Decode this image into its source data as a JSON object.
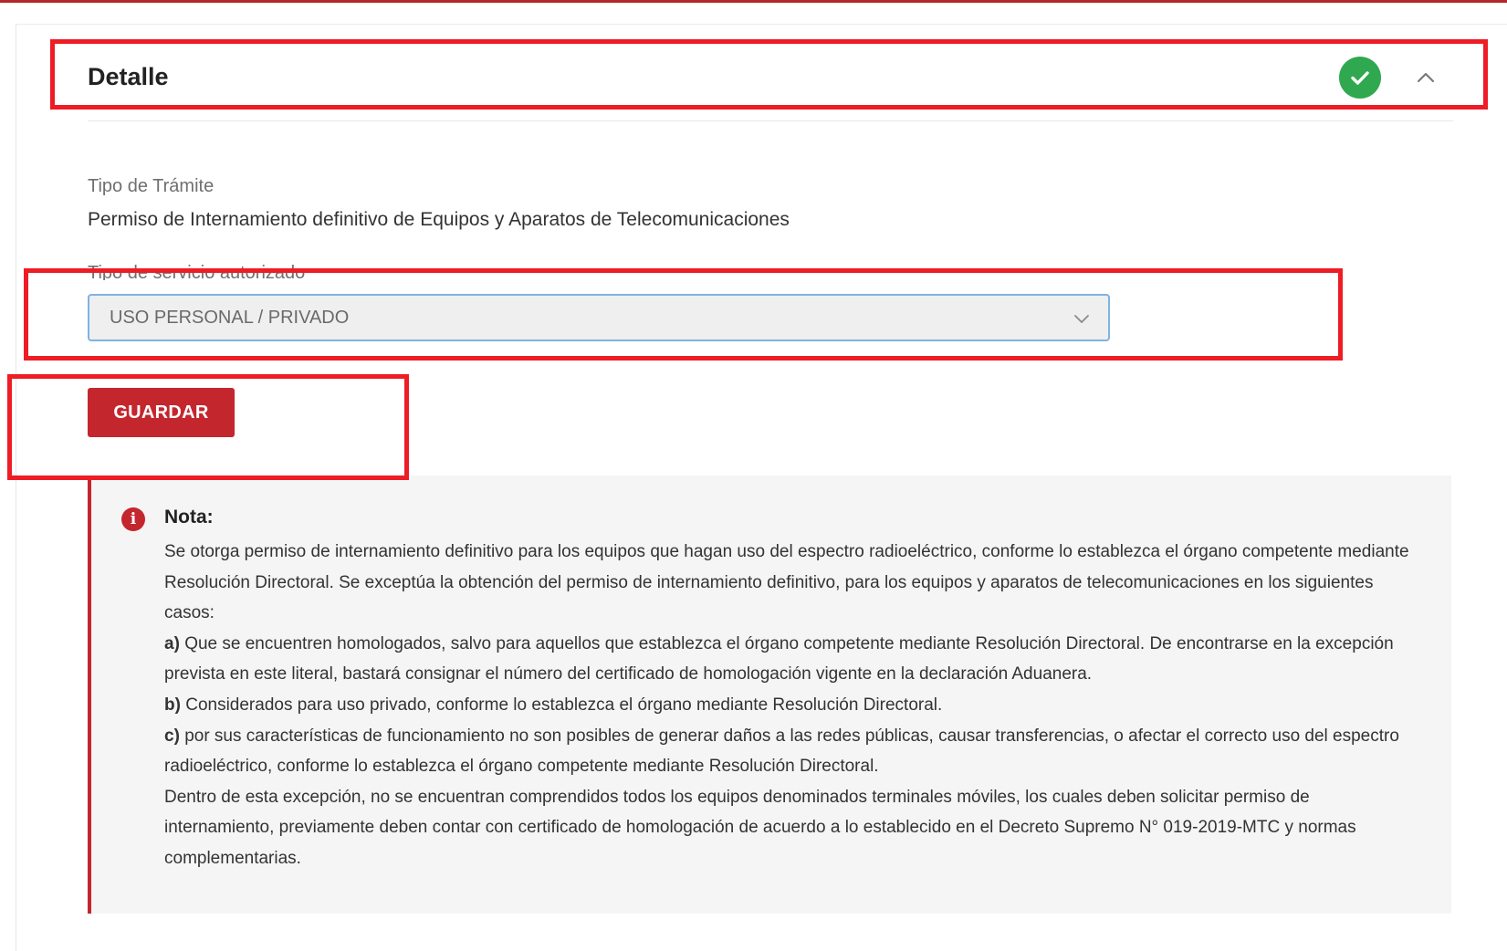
{
  "header": {
    "title": "Detalle",
    "status_icon": "check-circle-icon",
    "toggle_icon": "chevron-up-icon"
  },
  "tramite": {
    "label": "Tipo de Trámite",
    "value": "Permiso de Internamiento definitivo de Equipos y Aparatos de Telecomunicaciones"
  },
  "servicio": {
    "label": "Tipo de servicio autorizado",
    "selected": "USO PERSONAL / PRIVADO"
  },
  "actions": {
    "save_label": "GUARDAR"
  },
  "note": {
    "title": "Nota:",
    "intro": "Se otorga permiso de internamiento definitivo para los equipos que hagan uso del espectro radioeléctrico, conforme lo establezca el órgano competente mediante Resolución Directoral. Se exceptúa la obtención del permiso de internamiento definitivo, para los equipos y aparatos de telecomunicaciones en los siguientes casos:",
    "items": [
      {
        "marker": "a)",
        "text": "Que se encuentren homologados, salvo para aquellos que establezca el órgano competente mediante Resolución Directoral. De encontrarse en la excepción prevista en este literal, bastará consignar el número del certificado de homologación vigente en la declaración Aduanera."
      },
      {
        "marker": "b)",
        "text": "Considerados para uso privado, conforme lo establezca el órgano mediante Resolución Directoral."
      },
      {
        "marker": "c)",
        "text": "por sus características de funcionamiento no son posibles de generar daños a las redes públicas, causar transferencias, o afectar el correcto uso del espectro radioeléctrico, conforme lo establezca el órgano competente mediante Resolución Directoral."
      }
    ],
    "closing": "Dentro de esta excepción, no se encuentran comprendidos todos los equipos denominados terminales móviles, los cuales deben solicitar permiso de internamiento, previamente deben contar con certificado de homologación de acuerdo a lo establecido en el Decreto Supremo N° 019-2019-MTC y normas complementarias."
  },
  "colors": {
    "accent_red": "#c4262e",
    "success_green": "#2fa84f",
    "annotation_red": "#ee1c25",
    "select_border": "#7fb3e3"
  }
}
